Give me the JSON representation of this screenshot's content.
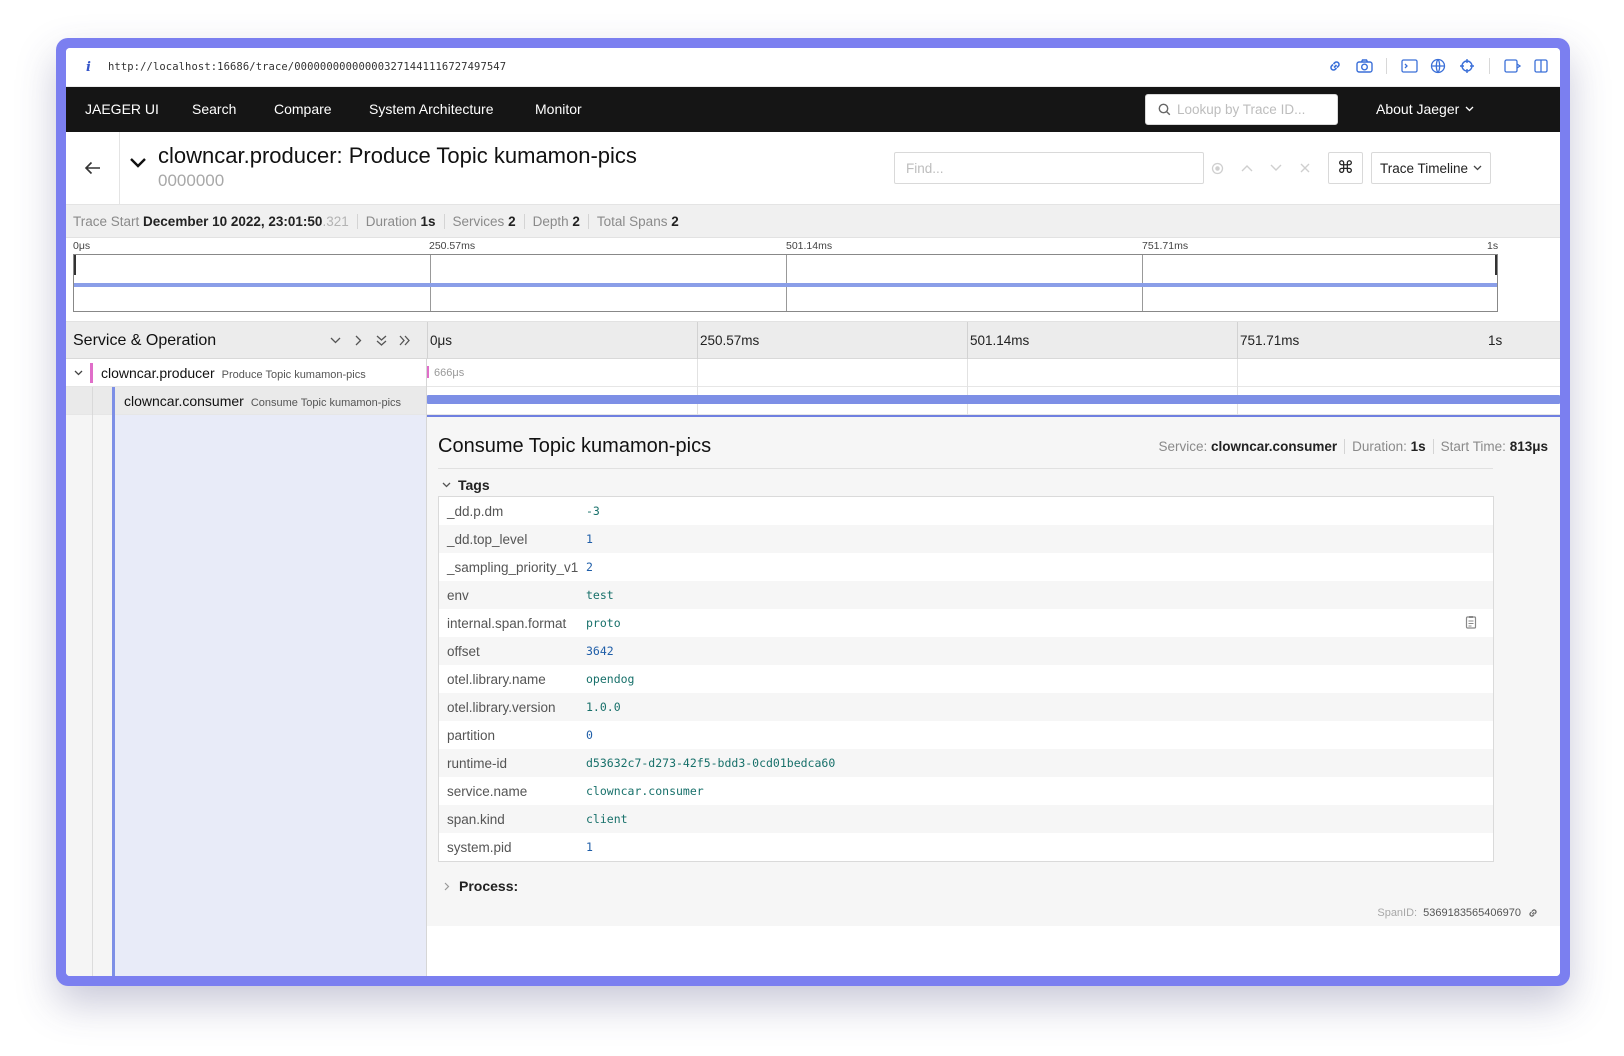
{
  "browser": {
    "info_glyph": "i",
    "url": "http://localhost:16686/trace/000000000000003271441116727497547"
  },
  "nav": {
    "brand": "JAEGER UI",
    "items": [
      "Search",
      "Compare",
      "System Architecture",
      "Monitor"
    ],
    "lookup_placeholder": "Lookup by Trace ID...",
    "about": "About Jaeger"
  },
  "trace": {
    "title": "clowncar.producer: Produce Topic kumamon-pics",
    "id": "0000000",
    "find_placeholder": "Find...",
    "kbd_glyph": "⌘",
    "view_select": "Trace Timeline"
  },
  "summary": {
    "trace_start_label": "Trace Start",
    "trace_start_value": "December 10 2022, 23:01:50",
    "trace_start_ms": ".321",
    "duration_label": "Duration",
    "duration_value": "1s",
    "services_label": "Services",
    "services_value": "2",
    "depth_label": "Depth",
    "depth_value": "2",
    "total_spans_label": "Total Spans",
    "total_spans_value": "2"
  },
  "minimap": {
    "ticks": [
      "0μs",
      "250.57ms",
      "501.14ms",
      "751.71ms",
      "1s"
    ]
  },
  "span_table": {
    "header_title": "Service & Operation",
    "ticks": [
      "0μs",
      "250.57ms",
      "501.14ms",
      "751.71ms",
      "1s"
    ]
  },
  "spans": [
    {
      "service": "clowncar.producer",
      "operation": "Produce Topic kumamon-pics",
      "duration_label": "666μs",
      "color": "#e06ec9"
    },
    {
      "service": "clowncar.consumer",
      "operation": "Consume Topic kumamon-pics",
      "color": "#7d8fe6"
    }
  ],
  "detail": {
    "title": "Consume Topic kumamon-pics",
    "service_label": "Service:",
    "service_value": "clowncar.consumer",
    "duration_label": "Duration:",
    "duration_value": "1s",
    "start_label": "Start Time:",
    "start_value": "813μs",
    "tags_label": "Tags",
    "tags": [
      {
        "key": "_dd.p.dm",
        "value": "-3",
        "kind": "str"
      },
      {
        "key": "_dd.top_level",
        "value": "1",
        "kind": "num"
      },
      {
        "key": "_sampling_priority_v1",
        "value": "2",
        "kind": "num"
      },
      {
        "key": "env",
        "value": "test",
        "kind": "str"
      },
      {
        "key": "internal.span.format",
        "value": "proto",
        "kind": "str"
      },
      {
        "key": "offset",
        "value": "3642",
        "kind": "num"
      },
      {
        "key": "otel.library.name",
        "value": "opendog",
        "kind": "str"
      },
      {
        "key": "otel.library.version",
        "value": "1.0.0",
        "kind": "str"
      },
      {
        "key": "partition",
        "value": "0",
        "kind": "num"
      },
      {
        "key": "runtime-id",
        "value": "d53632c7-d273-42f5-bdd3-0cd01bedca60",
        "kind": "str"
      },
      {
        "key": "service.name",
        "value": "clowncar.consumer",
        "kind": "str"
      },
      {
        "key": "span.kind",
        "value": "client",
        "kind": "str"
      },
      {
        "key": "system.pid",
        "value": "1",
        "kind": "num"
      }
    ],
    "process_label": "Process:",
    "spanid_label": "SpanID:",
    "spanid_value": "5369183565406970"
  },
  "colors": {
    "accent": "#7b7ff0",
    "nav_bg": "#151515",
    "span_bar": "#7d8fe6",
    "producer": "#e06ec9"
  }
}
